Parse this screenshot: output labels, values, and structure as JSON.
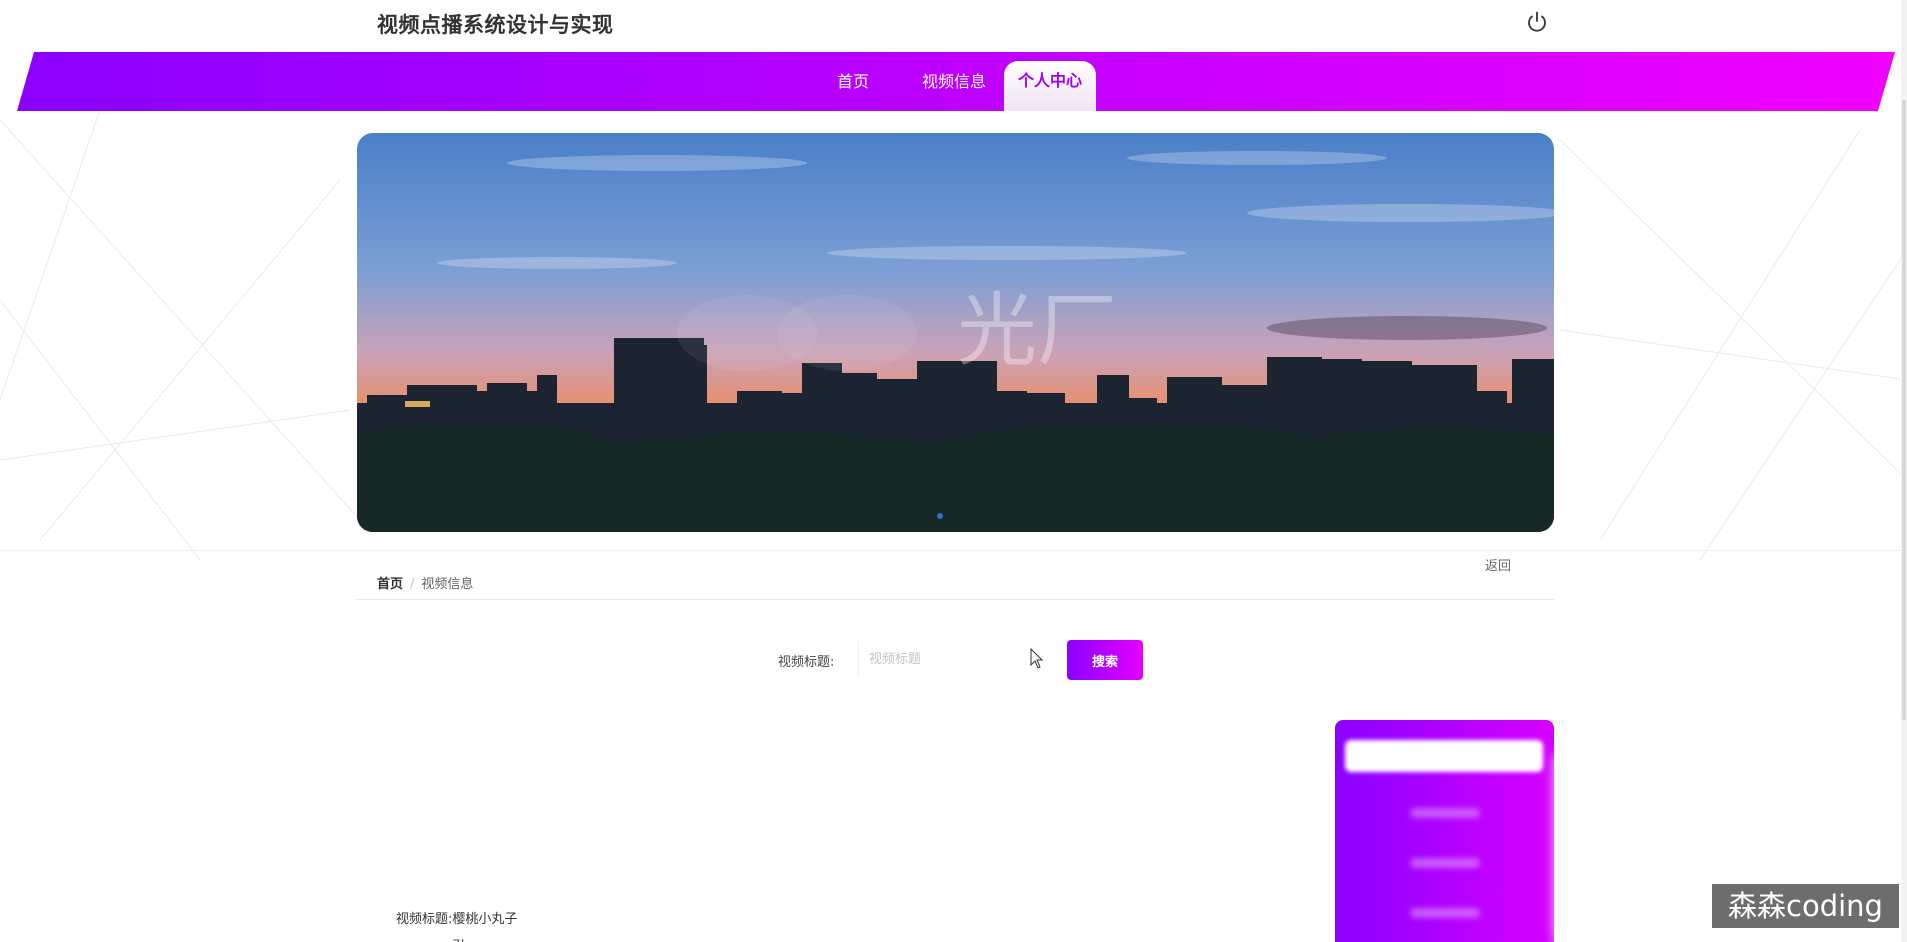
{
  "header": {
    "site_title": "视频点播系统设计与实现",
    "logout_icon": "power-icon"
  },
  "nav": {
    "items": [
      {
        "label": "首页"
      },
      {
        "label": "视频信息"
      },
      {
        "label": "个人中心",
        "active": true
      }
    ],
    "gradient_start": "#8a00ff",
    "gradient_end": "#f000ff"
  },
  "banner": {
    "watermark_text": "光厂",
    "description_icon": "city-skyline-banner"
  },
  "breadcrumb": {
    "home": "首页",
    "separator": "/",
    "current": "视频信息"
  },
  "back_label": "返回",
  "search": {
    "label": "视频标题:",
    "placeholder": "视频标题",
    "value": "",
    "button_label": "搜索"
  },
  "list": {
    "first_item_title_label": "视频标题:",
    "first_item_title_value": "樱桃小丸子",
    "second_line_partial": "引"
  },
  "watermark": {
    "text": "森森coding"
  },
  "colors": {
    "accent": "#9a00ff",
    "accent_end": "#e500ff"
  }
}
